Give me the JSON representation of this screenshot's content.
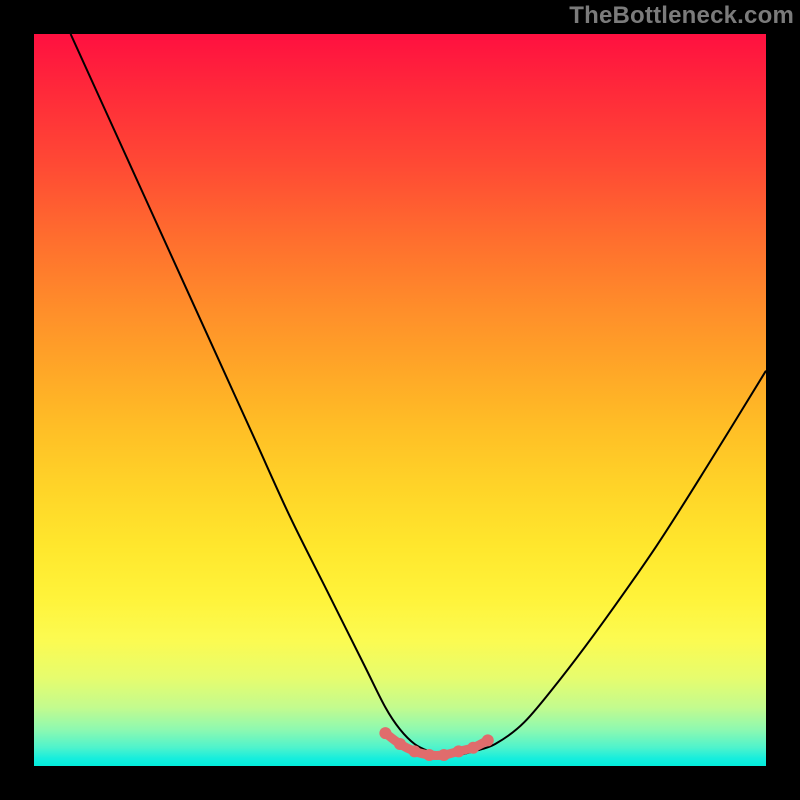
{
  "watermark": {
    "text": "TheBottleneck.com"
  },
  "colors": {
    "background": "#000000",
    "curve_stroke": "#000000",
    "marker_stroke": "#e06c6c",
    "marker_fill": "#e06c6c",
    "gradient_top": "#ff1040",
    "gradient_mid": "#ffd428",
    "gradient_bottom": "#02ecdc"
  },
  "chart_data": {
    "type": "line",
    "title": "",
    "xlabel": "",
    "ylabel": "",
    "xlim": [
      0,
      100
    ],
    "ylim": [
      0,
      100
    ],
    "grid": false,
    "legend": false,
    "series": [
      {
        "name": "bottleneck-curve",
        "x": [
          5,
          10,
          15,
          20,
          25,
          30,
          35,
          40,
          45,
          48,
          50,
          52,
          54,
          56,
          58,
          60,
          63,
          67,
          72,
          78,
          85,
          92,
          100
        ],
        "y": [
          100,
          89,
          78,
          67,
          56,
          45,
          34,
          24,
          14,
          8,
          5,
          3,
          2,
          1.5,
          1.5,
          2,
          3,
          6,
          12,
          20,
          30,
          41,
          54
        ]
      }
    ],
    "markers": {
      "name": "bottom-highlight",
      "x": [
        48,
        50,
        52,
        54,
        56,
        58,
        60,
        62
      ],
      "y": [
        4.5,
        3,
        2,
        1.5,
        1.5,
        2,
        2.5,
        3.5
      ]
    }
  }
}
